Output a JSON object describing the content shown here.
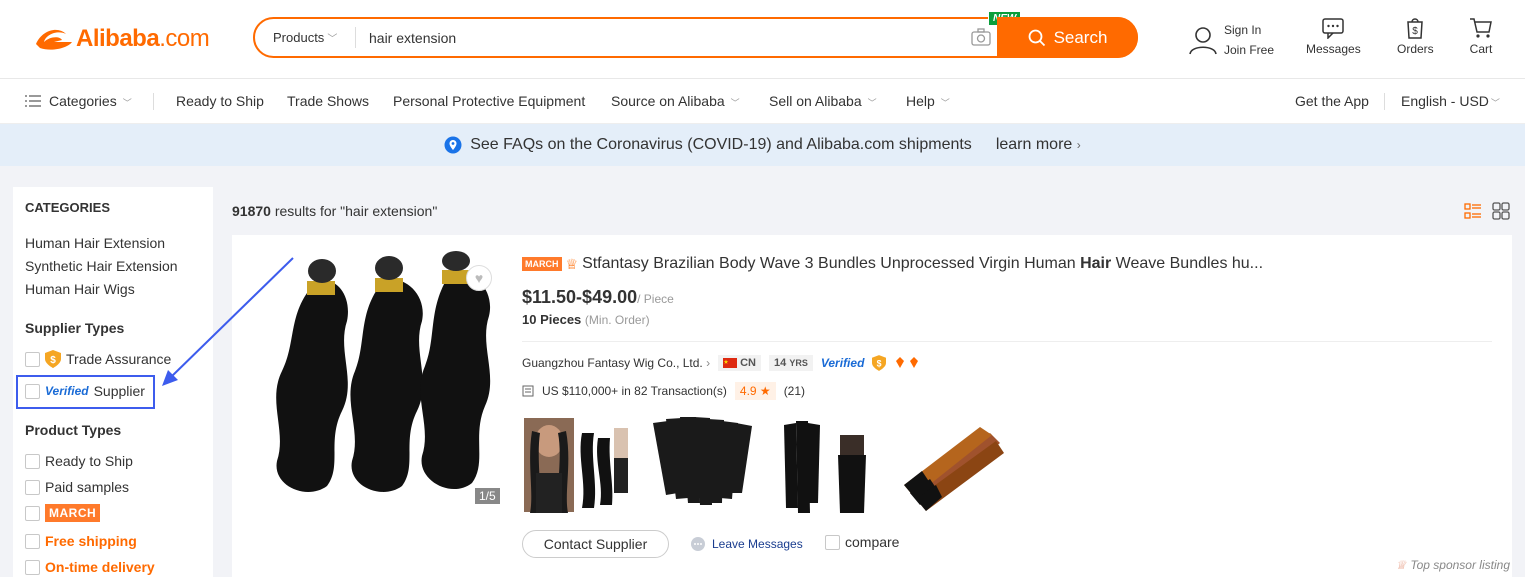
{
  "header": {
    "logo_text": "Alibaba",
    "logo_domain": ".com",
    "search_category": "Products",
    "search_value": "hair extension",
    "new_badge": "NEW",
    "search_button": "Search",
    "sign_in": "Sign In",
    "join_free": "Join Free",
    "messages": "Messages",
    "orders": "Orders",
    "cart": "Cart"
  },
  "nav": {
    "categories": "Categories",
    "items": [
      "Ready to Ship",
      "Trade Shows",
      "Personal Protective Equipment",
      "Source on Alibaba",
      "Sell on Alibaba",
      "Help"
    ],
    "get_app": "Get the App",
    "language": "English - USD"
  },
  "banner": {
    "text": "See FAQs on the Coronavirus (COVID-19) and Alibaba.com shipments",
    "link": "learn more"
  },
  "sidebar": {
    "categories_title": "CATEGORIES",
    "categories": [
      "Human Hair Extension",
      "Synthetic Hair Extension",
      "Human Hair Wigs"
    ],
    "supplier_types_title": "Supplier Types",
    "trade_assurance": "Trade Assurance",
    "verified_word": "Verified",
    "supplier_word": "Supplier",
    "product_types_title": "Product Types",
    "ready_to_ship": "Ready to Ship",
    "paid_samples": "Paid samples",
    "march": "MARCH",
    "free_shipping": "Free shipping",
    "on_time_delivery": "On-time delivery"
  },
  "results": {
    "count": "91870",
    "query_text": "results for \"hair extension\""
  },
  "product": {
    "march_badge": "MARCH",
    "title_before": "Stfantasy Brazilian Body Wave 3 Bundles Unprocessed Virgin Human ",
    "title_bold": "Hair",
    "title_after": " Weave Bundles hu...",
    "price": "$11.50-$49.00",
    "price_unit": "/ Piece",
    "moq": "10 Pieces",
    "moq_label": "(Min. Order)",
    "supplier_name": "Guangzhou Fantasy Wig Co., Ltd.",
    "country": "CN",
    "years": "14",
    "years_unit": "YRS",
    "verified": "Verified",
    "transactions": "US $110,000+ in 82 Transaction(s)",
    "rating": "4.9",
    "reviews": "(21)",
    "image_pager": "1/5",
    "contact_button": "Contact Supplier",
    "leave_messages": "Leave Messages",
    "compare": "compare",
    "sponsor": "Top sponsor listing"
  },
  "colors": {
    "brand": "#ff6a00",
    "annotation": "#3d5ced"
  }
}
